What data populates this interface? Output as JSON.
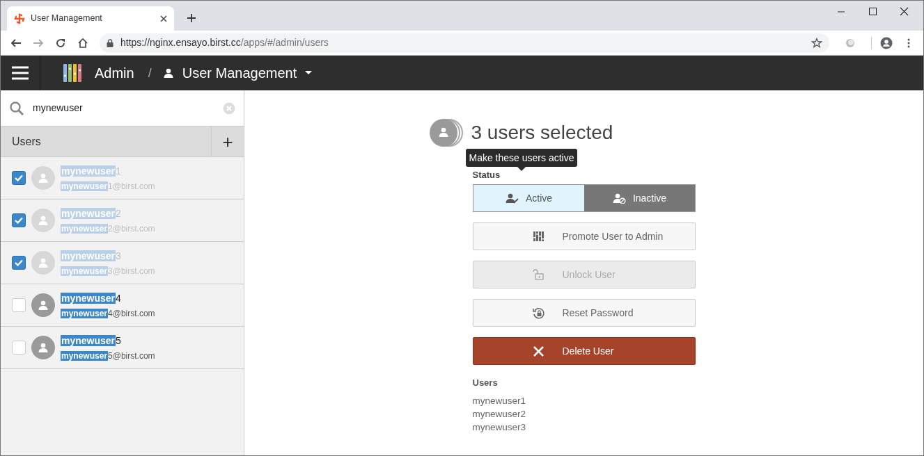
{
  "browser": {
    "tab_title": "User Management",
    "url_host": "https://nginx.ensayo.birst.cc",
    "url_path": "/apps/#/admin/users"
  },
  "header": {
    "section": "Admin",
    "separator": "/",
    "page": "User Management"
  },
  "sidebar": {
    "search": {
      "value": "mynewuser"
    },
    "title": "Users",
    "add": "+",
    "users": [
      {
        "match": "mynewuser",
        "name_rest": "1",
        "email_match": "mynewuser",
        "email_rest": "1@birst.com",
        "checked": true
      },
      {
        "match": "mynewuser",
        "name_rest": "2",
        "email_match": "mynewuser",
        "email_rest": "2@birst.com",
        "checked": true
      },
      {
        "match": "mynewuser",
        "name_rest": "3",
        "email_match": "mynewuser",
        "email_rest": "3@birst.com",
        "checked": true
      },
      {
        "match": "mynewuser",
        "name_rest": "4",
        "email_match": "mynewuser",
        "email_rest": "4@birst.com",
        "checked": false
      },
      {
        "match": "mynewuser",
        "name_rest": "5",
        "email_match": "mynewuser",
        "email_rest": "5@birst.com",
        "checked": false
      }
    ]
  },
  "detail": {
    "title": "3 users selected",
    "tooltip": "Make these users active",
    "status_label": "Status",
    "status": [
      {
        "label": "Active",
        "kind": "active",
        "selected": true
      },
      {
        "label": "Inactive",
        "kind": "inactive",
        "selected": false
      }
    ],
    "actions": [
      {
        "label": "Promote User to Admin",
        "kind": "promote",
        "disabled": false
      },
      {
        "label": "Unlock User",
        "kind": "unlock",
        "disabled": true
      },
      {
        "label": "Reset Password",
        "kind": "reset",
        "disabled": false
      },
      {
        "label": "Delete User",
        "kind": "delete",
        "disabled": false
      }
    ],
    "users_label": "Users",
    "users": [
      "mynewuser1",
      "mynewuser2",
      "mynewuser3"
    ]
  }
}
